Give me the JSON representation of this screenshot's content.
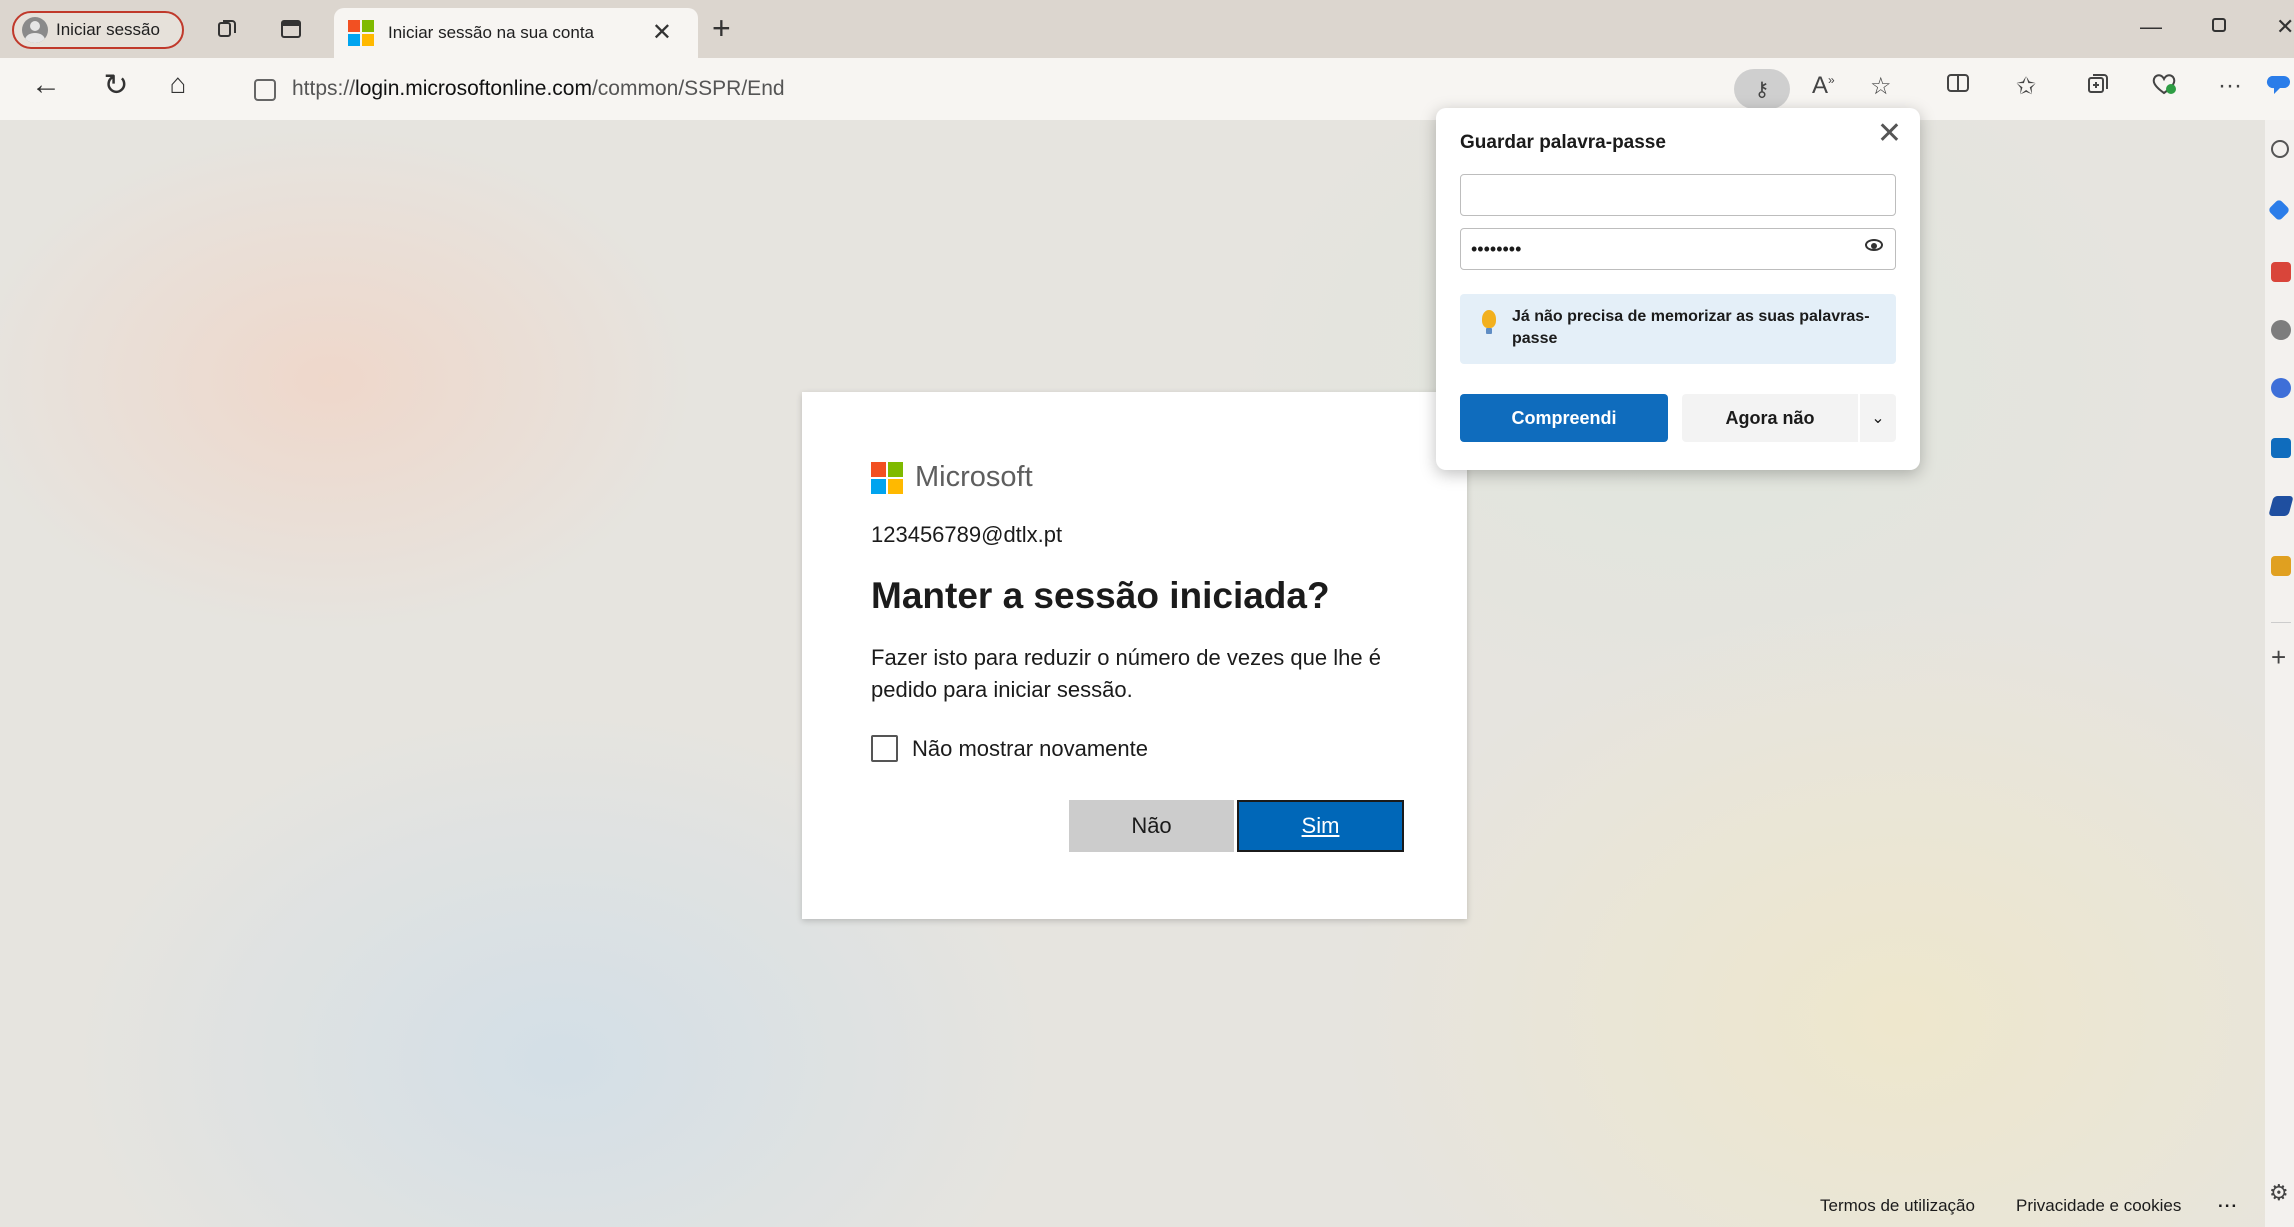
{
  "browser": {
    "profile_label": "Iniciar sessão",
    "tab_title": "Iniciar sessão na sua conta",
    "url_protocol": "https://",
    "url_host": "login.microsoftonline.com",
    "url_path": "/common/SSPR/End",
    "read_aloud_label": "A",
    "more_label": "···"
  },
  "brand_colors": {
    "ms_red": "#f25022",
    "ms_green": "#7fba00",
    "ms_blue": "#00a4ef",
    "ms_yellow": "#ffb900",
    "accent": "#0067b8"
  },
  "login_card": {
    "brand": "Microsoft",
    "identity": "123456789@dtlx.pt",
    "title": "Manter a sessão iniciada?",
    "description": "Fazer isto para reduzir o número de vezes que lhe é pedido para iniciar sessão.",
    "checkbox_label": "Não mostrar novamente",
    "checkbox_checked": false,
    "no_button": "Não",
    "yes_button": "Sim"
  },
  "footer": {
    "terms": "Termos de utilização",
    "privacy": "Privacidade e cookies",
    "more": "..."
  },
  "save_password_popup": {
    "title": "Guardar palavra-passe",
    "username_value": "",
    "password_value": "••••••••",
    "tip": "Já não precisa de memorizar as suas palavras-passe",
    "ok_button": "Compreendi",
    "not_now_button": "Agora não"
  }
}
